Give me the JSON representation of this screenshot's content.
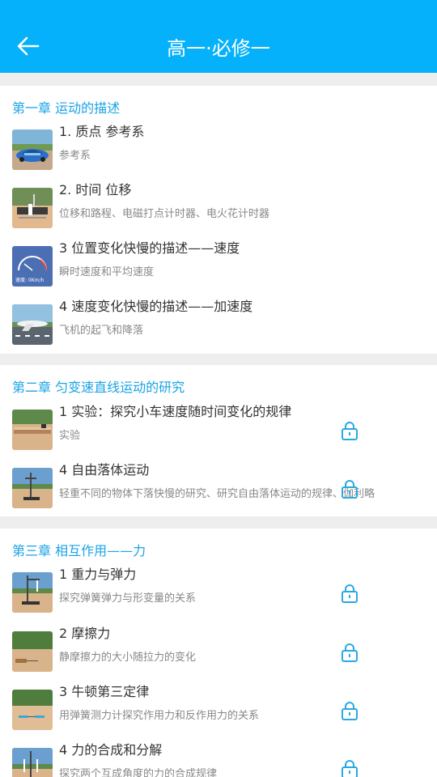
{
  "header": {
    "title": "高一·必修一",
    "back_icon": "back-arrow-icon"
  },
  "colors": {
    "header_bg": "#04b1fa",
    "chapter_title": "#1aa3e6",
    "lock": "#29a9e0"
  },
  "chapters": [
    {
      "title": "第一章 运动的描述",
      "lessons": [
        {
          "title": "1. 质点 参考系",
          "subtitle": "参考系",
          "thumb": "car-thumbnail",
          "locked": false
        },
        {
          "title": "2. 时间 位移",
          "subtitle": "位移和路程、电磁打点计时器、电火花计时器",
          "thumb": "timer-thumbnail",
          "locked": false
        },
        {
          "title": "3 位置变化快慢的描述——速度",
          "subtitle": "瞬时速度和平均速度",
          "thumb": "speedometer-thumbnail",
          "thumb_text": "速度: 0Km/h",
          "locked": false
        },
        {
          "title": "4 速度变化快慢的描述——加速度",
          "subtitle": "飞机的起飞和降落",
          "thumb": "airplane-thumbnail",
          "locked": false
        }
      ]
    },
    {
      "title": "第二章 匀变速直线运动的研究",
      "lessons": [
        {
          "title": "1 实验：探究小车速度随时间变化的规律",
          "subtitle": "实验",
          "thumb": "track-thumbnail",
          "locked": true
        },
        {
          "title": "4 自由落体运动",
          "subtitle": "轻重不同的物体下落快慢的研究、研究自由落体运动的规律、伽利略",
          "thumb": "stand-thumbnail",
          "locked": true
        }
      ]
    },
    {
      "title": "第三章 相互作用——力",
      "lessons": [
        {
          "title": "1 重力与弹力",
          "subtitle": "探究弹簧弹力与形变量的关系",
          "thumb": "spring-thumbnail",
          "locked": true
        },
        {
          "title": "2 摩擦力",
          "subtitle": "静摩擦力的大小随拉力的变化",
          "thumb": "friction-thumbnail",
          "locked": true
        },
        {
          "title": "3 牛顿第三定律",
          "subtitle": "用弹簧测力计探究作用力和反作用力的关系",
          "thumb": "newton-thumbnail",
          "locked": true
        },
        {
          "title": "4 力的合成和分解",
          "subtitle": "探究两个互成角度的力的合成规律",
          "thumb": "force-thumbnail",
          "locked": true
        }
      ]
    }
  ]
}
